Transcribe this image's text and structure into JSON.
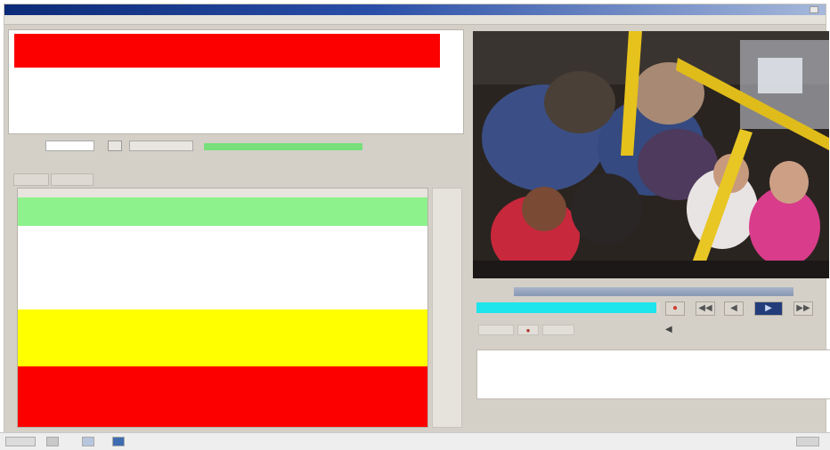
{
  "window": {
    "title": ""
  },
  "menu": {
    "items": [
      "",
      "",
      "",
      "",
      ""
    ]
  },
  "alert_panel": {
    "rows": [
      {
        "col1": "",
        "col2": "",
        "color": "#fc0000"
      }
    ]
  },
  "filter": {
    "label": "",
    "input_value": "",
    "progress": 1.0,
    "progress_color": "#78e07a"
  },
  "status_line": "",
  "tabs": [
    "",
    ""
  ],
  "table": {
    "columns": [
      "",
      "",
      "",
      "",
      "",
      "",
      ""
    ],
    "row_colors": [
      "#8ef28c",
      "#8ef28c",
      "#ffffff",
      "#ffffff",
      "#ffffff",
      "#ffffff",
      "#ffffff",
      "#ffffff",
      "#ffff00",
      "#ffff00",
      "#ffff00",
      "#ffff00",
      "#fc0000",
      "#fc0000",
      "#fc0000",
      "#fc0000",
      "#fc0000"
    ]
  },
  "video": {
    "description_free": true
  },
  "playback": {
    "timeline_position": 1.0,
    "progress": 0.98,
    "progress_color": "#1ee4ec",
    "buttons": [
      "record-icon",
      "rewind-icon",
      "step-back-icon",
      "play-icon",
      "fast-forward-icon"
    ]
  },
  "notes": {
    "label": ""
  },
  "statusbar": {
    "clock": ""
  },
  "colors": {
    "critical": "#fc0000",
    "warning": "#ffff00",
    "ok": "#8ef28c",
    "progress": "#1ee4ec"
  }
}
